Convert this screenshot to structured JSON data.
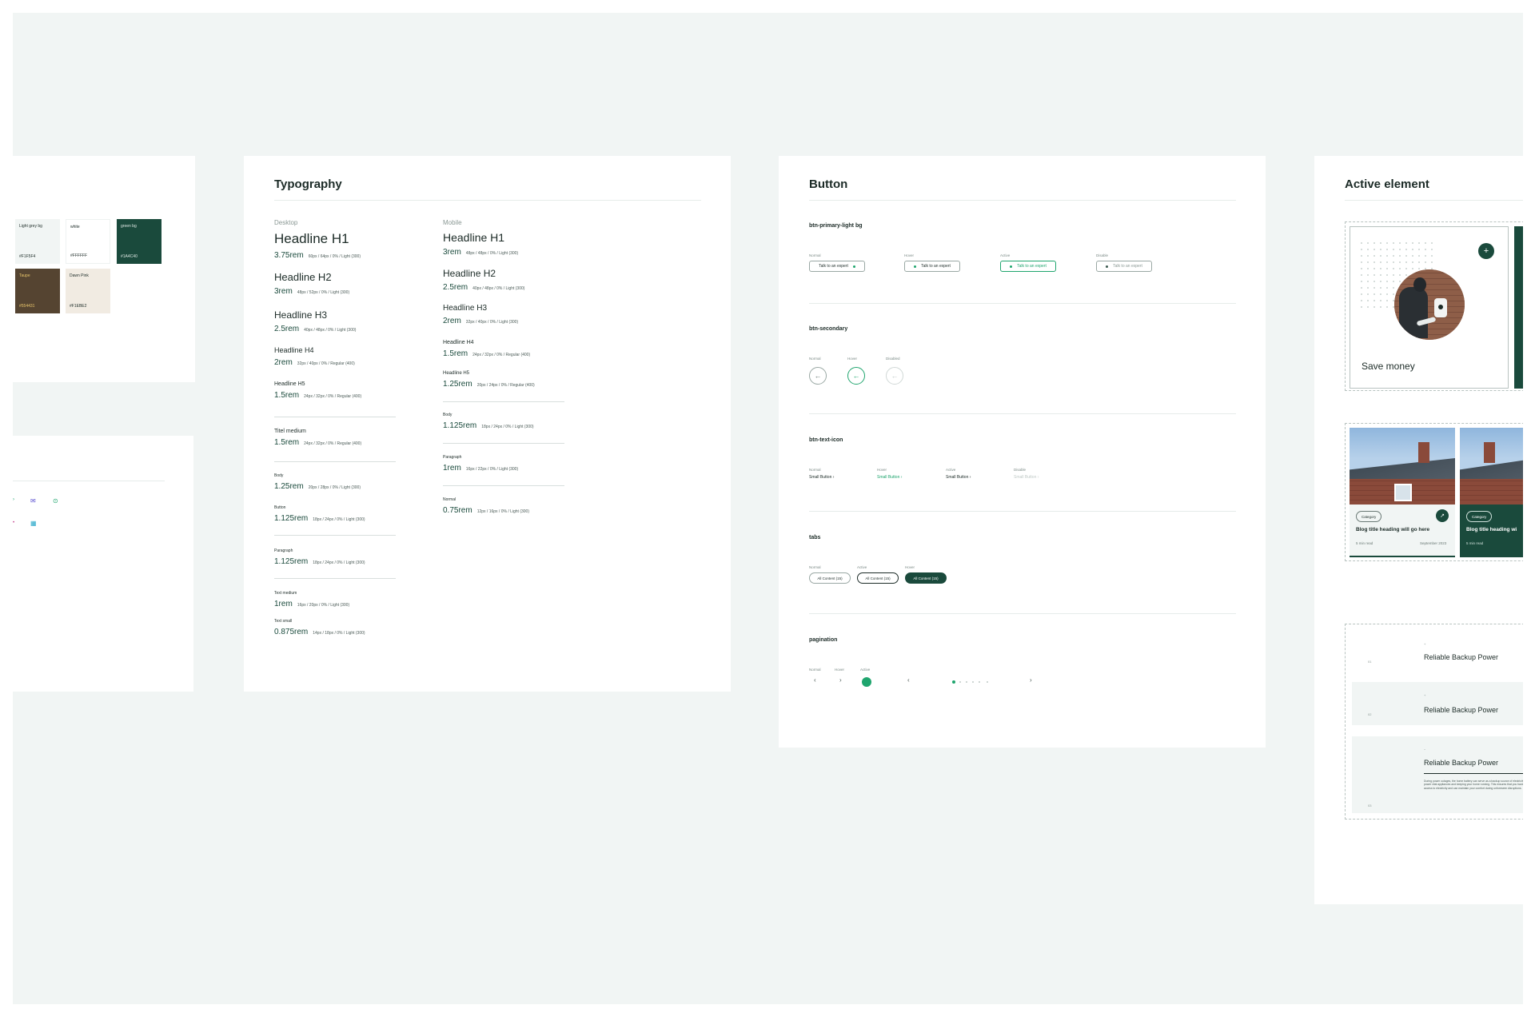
{
  "colors": {
    "canvas_bg": "#f1f5f4",
    "brand_green": "#1a4a3c",
    "accent_green": "#1fa56e",
    "taupe": "#554431",
    "dawn_pink": "#f1ebe2"
  },
  "palette": {
    "swatches": [
      {
        "name": "Light grey bg",
        "hex": "#F1F5F4"
      },
      {
        "name": "white",
        "hex": "#FFFFFF"
      },
      {
        "name": "green bg",
        "hex": "#1A4C40"
      },
      {
        "name": "Taupe",
        "hex": "#554431"
      },
      {
        "name": "Dawn Pink",
        "hex": "#F1EBE2"
      }
    ]
  },
  "typography": {
    "title": "Typography",
    "desktop_label": "Desktop",
    "mobile_label": "Mobile",
    "desktop": [
      {
        "name": "Headline H1",
        "size": "3.75rem",
        "spec": "60px / 64px / 0% / Light (300)"
      },
      {
        "name": "Headline H2",
        "size": "3rem",
        "spec": "48px / 52px / 0% / Light (300)"
      },
      {
        "name": "Headline H3",
        "size": "2.5rem",
        "spec": "40px / 48px / 0% / Light (300)"
      },
      {
        "name": "Headline H4",
        "size": "2rem",
        "spec": "32px / 40px / 0% / Regular (400)"
      },
      {
        "name": "Headline H5",
        "size": "1.5rem",
        "spec": "24px / 32px / 0% / Regular (400)"
      },
      {
        "name": "Titel medium",
        "size": "1.5rem",
        "spec": "24px / 32px / 0% / Regular (400)"
      },
      {
        "name": "Body",
        "size": "1.25rem",
        "spec": "20px / 28px / 0% / Light (300)"
      },
      {
        "name": "Button",
        "size": "1.125rem",
        "spec": "18px / 24px / 0% / Light (300)"
      },
      {
        "name": "Paragraph",
        "size": "1.125rem",
        "spec": "18px / 24px / 0% / Light (300)"
      },
      {
        "name": "Text medium",
        "size": "1rem",
        "spec": "16px / 20px / 0% / Light (300)"
      },
      {
        "name": "Text small",
        "size": "0.875rem",
        "spec": "14px / 18px / 0% / Light (300)"
      }
    ],
    "mobile": [
      {
        "name": "Headline H1",
        "size": "3rem",
        "spec": "48px / 48px / 0% / Light (300)"
      },
      {
        "name": "Headline H2",
        "size": "2.5rem",
        "spec": "40px / 48px / 0% / Light (300)"
      },
      {
        "name": "Headline H3",
        "size": "2rem",
        "spec": "32px / 40px / 0% / Light (300)"
      },
      {
        "name": "Headline H4",
        "size": "1.5rem",
        "spec": "24px / 32px / 0% / Regular (400)"
      },
      {
        "name": "Headline H5",
        "size": "1.25rem",
        "spec": "20px / 24px / 0% / Regular (400)"
      },
      {
        "name": "Body",
        "size": "1.125rem",
        "spec": "18px / 24px / 0% / Light (300)"
      },
      {
        "name": "Paragraph",
        "size": "1rem",
        "spec": "16px / 22px / 0% / Light (300)"
      },
      {
        "name": "Normal",
        "size": "0.75rem",
        "spec": "12px / 16px / 0% / Light (300)"
      }
    ]
  },
  "buttons": {
    "title": "Button",
    "primary": {
      "label": "btn-primary-light bg",
      "states": [
        "Normal",
        "Hover",
        "Active",
        "Disable"
      ],
      "text": "Talk to an expert"
    },
    "secondary": {
      "label": "btn-secondary",
      "states": [
        "Normal",
        "Hover",
        "Disabled"
      ],
      "glyph": "←"
    },
    "text_icon": {
      "label": "btn-text-icon",
      "states": [
        "Normal",
        "Hover",
        "Active",
        "Disable"
      ],
      "text": "Small Button"
    },
    "tabs": {
      "label": "tabs",
      "states": [
        "Normal",
        "Active",
        "Hover"
      ],
      "text": "All Content (15)"
    },
    "pagination": {
      "label": "pagination",
      "states": [
        "Normal",
        "Hover",
        "Active"
      ],
      "prev": "‹",
      "next": "›"
    }
  },
  "active_element": {
    "title": "Active element",
    "card": {
      "label": "Save money",
      "plus": "+"
    },
    "blog": [
      {
        "category": "Category",
        "title": "Blog title heading will go here",
        "read": "5 min read",
        "date": "September 2023",
        "arrow": "↗"
      },
      {
        "category": "Category",
        "title": "Blog title heading wi",
        "read": "5 min read"
      }
    ],
    "accordion": [
      {
        "num": "01",
        "title": "Reliable Backup Power"
      },
      {
        "num": "02",
        "title": "Reliable Backup Power"
      },
      {
        "num": "03",
        "title": "Reliable Backup Power",
        "body": "During power outages, the home battery can serve as a backup source of electricity to power vital appliances and keeping your home running. This ensures that you have access to electricity and can maintain your comfort during unforeseen disruptions."
      }
    ]
  }
}
